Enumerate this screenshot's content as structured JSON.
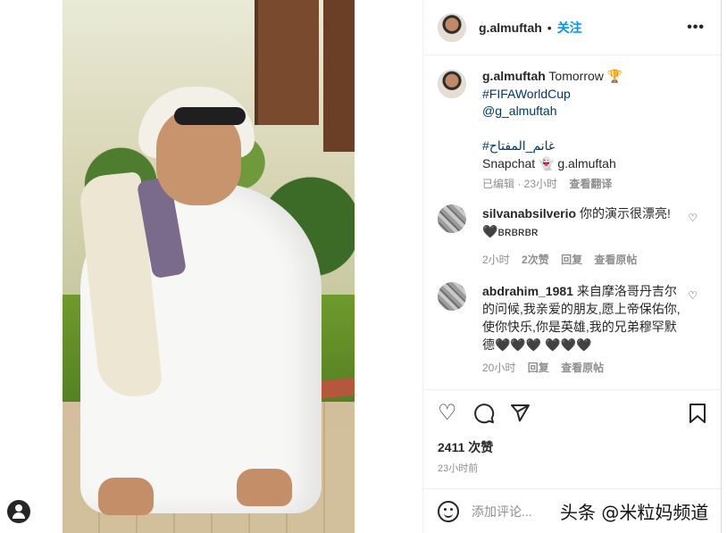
{
  "post": {
    "username": "g.almuftah",
    "separator": "•",
    "follow_label": "关注",
    "more_icon": "more-options-icon"
  },
  "caption": {
    "username": "g.almuftah",
    "text_line1": "Tomorrow 🏆",
    "hashtag": "#FIFAWorldCup",
    "mention": "@g_almuftah",
    "arabic_tag": "#غانم_المفتاح",
    "snapchat_label": "Snapchat 👻 g.almuftah",
    "edited": "已编辑 · 23小时",
    "see_translation": "查看翻译"
  },
  "comments": [
    {
      "username": "silvanabsilverio",
      "text": "你的演示很漂亮! 🖤ʙʀʙʀʙʀ",
      "time": "2小时",
      "likes": "2次赞",
      "reply": "回复",
      "see_original": "查看原帖"
    },
    {
      "username": "abdrahim_1981",
      "text": "来自摩洛哥丹吉尔的问候,我亲爱的朋友,愿上帝保佑你,使你快乐,你是英雄,我的兄弟穆罕默德🖤🖤🖤 🖤🖤🖤",
      "time": "20小时",
      "reply": "回复",
      "see_original": "查看原帖"
    }
  ],
  "actions": {
    "like_icon": "heart-outline-icon",
    "comment_icon": "comment-bubble-icon",
    "share_icon": "paper-plane-icon",
    "save_icon": "bookmark-icon"
  },
  "likes_count": "2411 次赞",
  "posted_time": "23小时前",
  "add_comment": {
    "placeholder": "添加评论...",
    "emoji_icon": "emoji-smiley-icon"
  },
  "watermark": "头条 @米粒妈频道"
}
